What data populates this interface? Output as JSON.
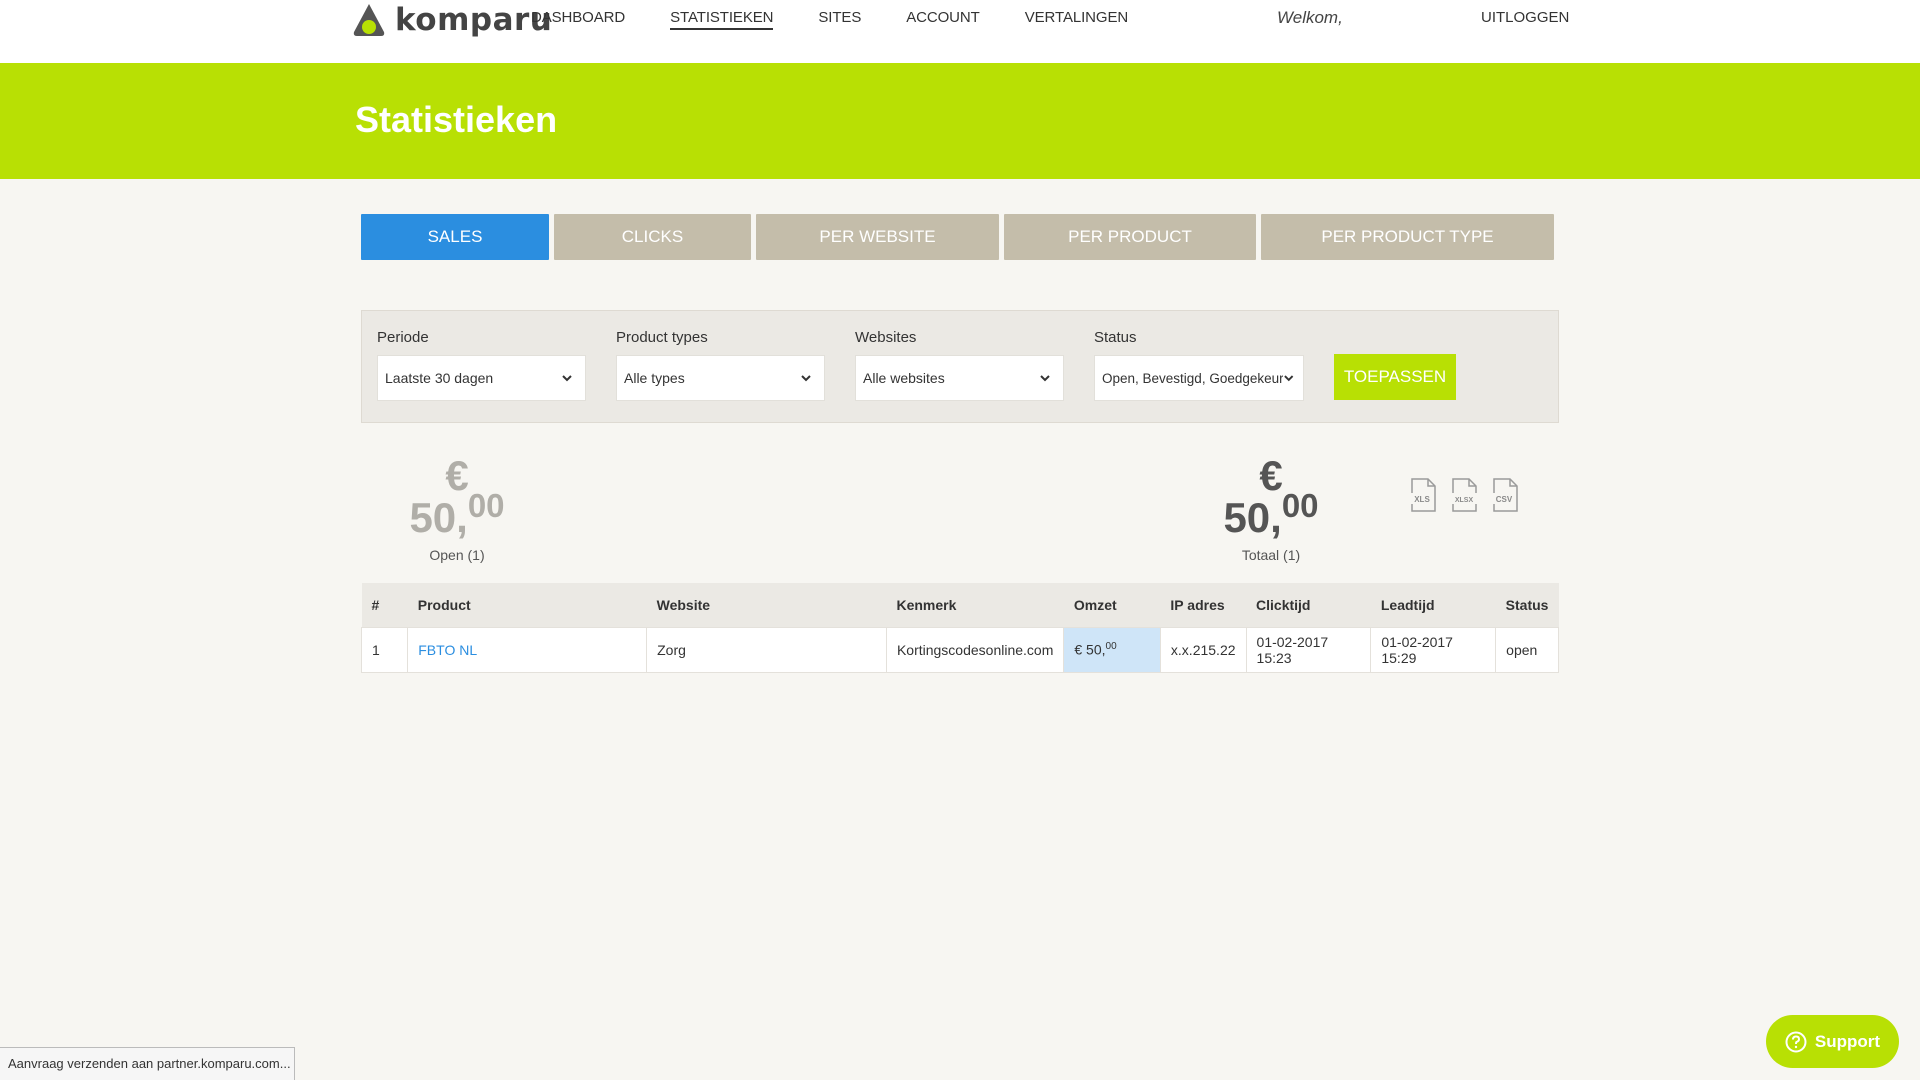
{
  "header": {
    "logo_text": "komparu",
    "nav": [
      "DASHBOARD",
      "STATISTIEKEN",
      "SITES",
      "ACCOUNT",
      "VERTALINGEN"
    ],
    "active_nav": "STATISTIEKEN",
    "welcome": "Welkom,",
    "logout": "UITLOGGEN"
  },
  "banner": {
    "title": "Statistieken"
  },
  "tabs": [
    {
      "label": "SALES",
      "active": true
    },
    {
      "label": "CLICKS",
      "active": false
    },
    {
      "label": "PER WEBSITE",
      "active": false
    },
    {
      "label": "PER PRODUCT",
      "active": false
    },
    {
      "label": "PER PRODUCT TYPE",
      "active": false
    }
  ],
  "filters": {
    "periode": {
      "label": "Periode",
      "value": "Laatste 30 dagen"
    },
    "product_types": {
      "label": "Product types",
      "value": "Alle types"
    },
    "websites": {
      "label": "Websites",
      "value": "Alle websites"
    },
    "status": {
      "label": "Status",
      "value": "Open, Bevestigd, Goedgekeurd"
    },
    "apply_label": "TOEPASSEN"
  },
  "totals": {
    "open": {
      "amount_main": "€ 50,",
      "amount_cents": "00",
      "caption": "Open (1)"
    },
    "total": {
      "amount_main": "€ 50,",
      "amount_cents": "00",
      "caption": "Totaal (1)"
    }
  },
  "exports": [
    "XLS",
    "XLSX",
    "CSV"
  ],
  "table": {
    "columns": [
      "#",
      "Product",
      "Website",
      "Kenmerk",
      "Omzet",
      "IP adres",
      "Clicktijd",
      "Leadtijd",
      "Status"
    ],
    "rows": [
      {
        "num": "1",
        "product": "FBTO NL",
        "website": "Zorg",
        "kenmerk": "Kortingscodesonline.com",
        "omzet_main": "€ 50,",
        "omzet_cents": "00",
        "ip": "x.x.215.22",
        "clicktijd": "01-02-2017 15:23",
        "leadtijd": "01-02-2017 15:29",
        "status": "open"
      }
    ]
  },
  "status_bar": "Aanvraag verzenden aan partner.komparu.com...",
  "support_label": "Support",
  "colors": {
    "brand_green": "#b8e004",
    "active_blue": "#2b8ee0",
    "tab_inactive": "#c4bdaa"
  }
}
